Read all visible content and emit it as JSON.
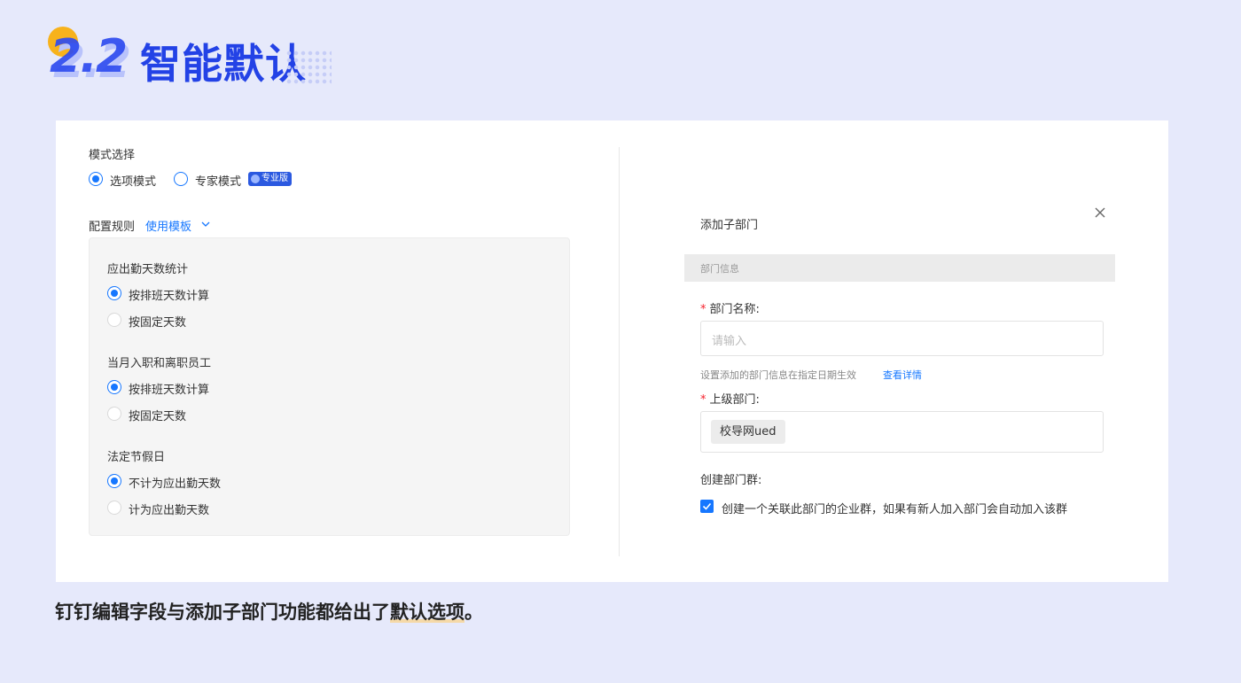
{
  "heading": {
    "number": "2.2",
    "title": "智能默认"
  },
  "left": {
    "mode_label": "模式选择",
    "modes": [
      {
        "label": "选项模式",
        "selected": true
      },
      {
        "label": "专家模式",
        "selected": false,
        "badge": "专业版"
      }
    ],
    "config_label": "配置规则",
    "template_link": "使用模板",
    "groups": [
      {
        "title": "应出勤天数统计",
        "options": [
          {
            "label": "按排班天数计算",
            "selected": true
          },
          {
            "label": "按固定天数",
            "selected": false
          }
        ]
      },
      {
        "title": "当月入职和离职员工",
        "options": [
          {
            "label": "按排班天数计算",
            "selected": true
          },
          {
            "label": "按固定天数",
            "selected": false
          }
        ]
      },
      {
        "title": "法定节假日",
        "options": [
          {
            "label": "不计为应出勤天数",
            "selected": true
          },
          {
            "label": "计为应出勤天数",
            "selected": false
          }
        ]
      }
    ]
  },
  "right": {
    "dialog_title": "添加子部门",
    "section_title": "部门信息",
    "dept_name_label": "部门名称:",
    "dept_name_placeholder": "请输入",
    "hint_text": "设置添加的部门信息在指定日期生效",
    "hint_link": "查看详情",
    "parent_label": "上级部门:",
    "parent_tag": "校导网ued",
    "group_label": "创建部门群:",
    "group_checkbox_text": "创建一个关联此部门的企业群，如果有新人加入部门会自动加入该群",
    "group_checked": true
  },
  "caption": {
    "text_prefix": "钉钉编辑字段与添加子部门功能都给出了",
    "text_highlight": "默认选项",
    "text_suffix": "。"
  },
  "colors": {
    "accent": "#1677ff",
    "heading_blue": "#2342e6",
    "heading_dot": "#f7b21c",
    "background": "#e6e9fb"
  }
}
